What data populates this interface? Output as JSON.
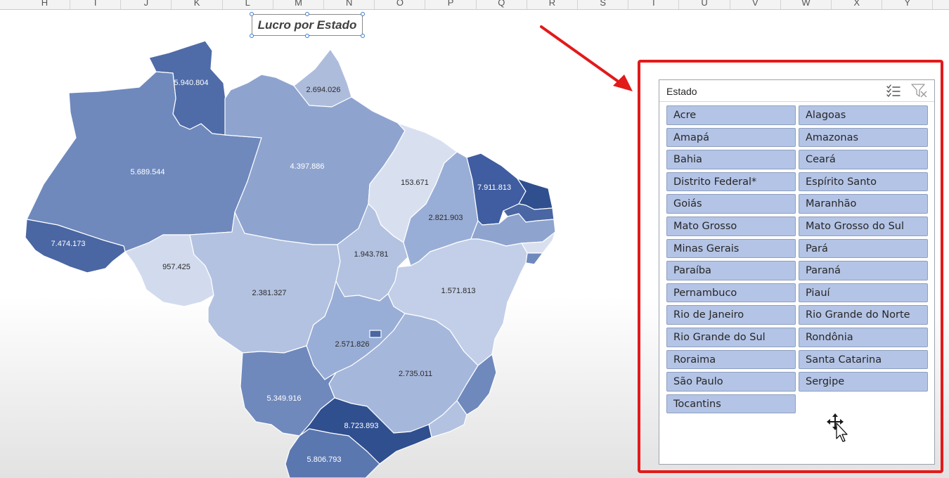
{
  "spreadsheet": {
    "columns": [
      "H",
      "I",
      "J",
      "K",
      "L",
      "M",
      "N",
      "O",
      "P",
      "Q",
      "R",
      "S",
      "T",
      "U",
      "V",
      "W",
      "X",
      "Y"
    ]
  },
  "map": {
    "title": "Lucro por Estado",
    "values": {
      "roraima": "5.940.804",
      "amapa": "2.694.026",
      "amazonas": "5.689.544",
      "para": "4.397.886",
      "acre": "7.474.173",
      "rondonia": "957.425",
      "mato_grosso": "2.381.327",
      "tocantins": "1.943.781",
      "maranhao": "153.671",
      "piaui": "2.821.903",
      "ceara": "7.911.813",
      "bahia": "1.571.813",
      "goias": "2.571.826",
      "minas_gerais": "2.735.011",
      "mato_grosso_do_sul": "5.349.916",
      "sao_paulo": "8.723.893",
      "parana": "5.806.793"
    },
    "colors": {
      "darkest": "#2f4f8f",
      "dark": "#4c6aa6",
      "medium_dark": "#6f89bd",
      "medium": "#8ea4cf",
      "light": "#b3c2e0",
      "lightest": "#d8e0f0",
      "border": "#ffffff"
    }
  },
  "slicer": {
    "title": "Estado",
    "multi_select_icon": "multi-select-icon",
    "clear_filter_icon": "clear-filter-icon",
    "items": [
      "Acre",
      "Alagoas",
      "Amapá",
      "Amazonas",
      "Bahia",
      "Ceará",
      "Distrito Federal*",
      "Espírito Santo",
      "Goiás",
      "Maranhão",
      "Mato Grosso",
      "Mato Grosso do Sul",
      "Minas Gerais",
      "Pará",
      "Paraíba",
      "Paraná",
      "Pernambuco",
      "Piauí",
      "Rio de Janeiro",
      "Rio Grande do Norte",
      "Rio Grande do Sul",
      "Rondônia",
      "Roraima",
      "Santa Catarina",
      "São Paulo",
      "Sergipe",
      "Tocantins"
    ]
  },
  "annotation": {
    "arrow_color": "#e21a1a",
    "highlight_color": "#e21a1a"
  }
}
